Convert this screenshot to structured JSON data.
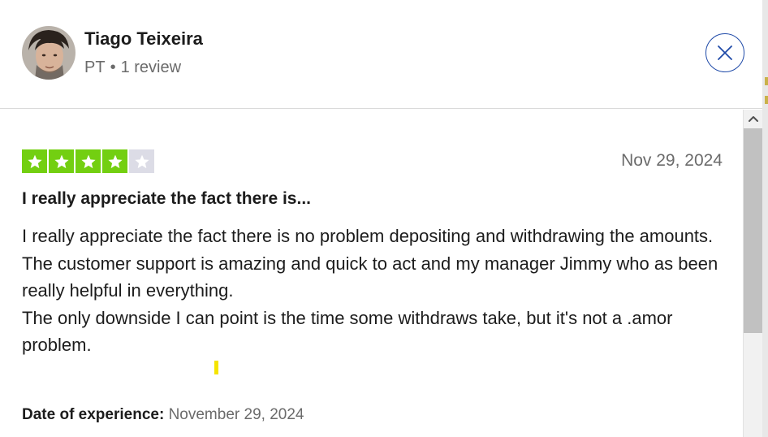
{
  "reviewer": {
    "name": "Tiago Teixeira",
    "country": "PT",
    "separator": "•",
    "review_count": "1 review"
  },
  "review": {
    "rating": 4,
    "max_rating": 5,
    "date": "Nov 29, 2024",
    "title": "I really appreciate the fact there is...",
    "body": [
      "I really appreciate the fact there is no problem depositing and withdrawing the amounts.",
      "The customer support is amazing and quick to act and my manager Jimmy who as been really helpful in everything.",
      "The only downside I can point is the time some withdraws take, but it's not a .amor problem."
    ],
    "experience_label": "Date of experience:",
    "experience_date": "November 29, 2024"
  },
  "icons": {
    "close": "close-icon",
    "star": "star-icon",
    "scroll_up": "chevron-up-icon"
  },
  "colors": {
    "star_on": "#73cf11",
    "star_off": "#dcdce6",
    "close_border": "#1f4aa8",
    "text_muted": "#6b6b6b"
  }
}
